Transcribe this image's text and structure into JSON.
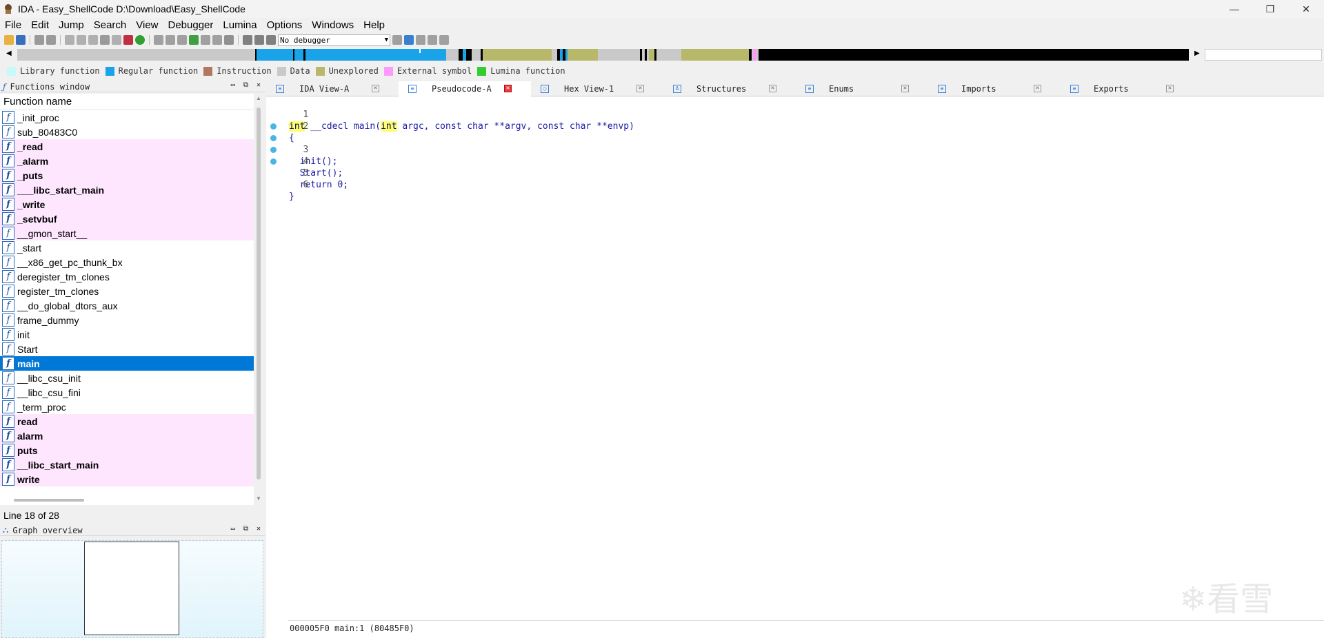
{
  "window": {
    "title": "IDA - Easy_ShellCode D:\\Download\\Easy_ShellCode",
    "minimize": "—",
    "restore": "❐",
    "close": "✕"
  },
  "menu": [
    "File",
    "Edit",
    "Jump",
    "Search",
    "View",
    "Debugger",
    "Lumina",
    "Options",
    "Windows",
    "Help"
  ],
  "toolbar": {
    "debugger_select": "No debugger"
  },
  "legend": [
    {
      "label": "Library function",
      "color": "#c8f8f8"
    },
    {
      "label": "Regular function",
      "color": "#1aa3e8"
    },
    {
      "label": "Instruction",
      "color": "#b07860"
    },
    {
      "label": "Data",
      "color": "#c9c9c9"
    },
    {
      "label": "Unexplored",
      "color": "#b8b86a"
    },
    {
      "label": "External symbol",
      "color": "#ff99ff"
    },
    {
      "label": "Lumina function",
      "color": "#33cc33"
    }
  ],
  "functions_window": {
    "title": "Functions window",
    "column_header": "Function name",
    "items": [
      {
        "name": "_init_proc",
        "kind": "regular"
      },
      {
        "name": "sub_80483C0",
        "kind": "regular"
      },
      {
        "name": "_read",
        "kind": "lib"
      },
      {
        "name": "_alarm",
        "kind": "lib"
      },
      {
        "name": "_puts",
        "kind": "lib"
      },
      {
        "name": "___libc_start_main",
        "kind": "lib"
      },
      {
        "name": "_write",
        "kind": "lib"
      },
      {
        "name": "_setvbuf",
        "kind": "lib"
      },
      {
        "name": "__gmon_start__",
        "kind": "lib-light"
      },
      {
        "name": "_start",
        "kind": "regular"
      },
      {
        "name": "__x86_get_pc_thunk_bx",
        "kind": "regular"
      },
      {
        "name": "deregister_tm_clones",
        "kind": "regular"
      },
      {
        "name": "register_tm_clones",
        "kind": "regular"
      },
      {
        "name": "__do_global_dtors_aux",
        "kind": "regular"
      },
      {
        "name": "frame_dummy",
        "kind": "regular"
      },
      {
        "name": "init",
        "kind": "regular"
      },
      {
        "name": "Start",
        "kind": "regular"
      },
      {
        "name": "main",
        "kind": "selected"
      },
      {
        "name": "__libc_csu_init",
        "kind": "regular"
      },
      {
        "name": "__libc_csu_fini",
        "kind": "regular"
      },
      {
        "name": "_term_proc",
        "kind": "regular"
      },
      {
        "name": "read",
        "kind": "lib"
      },
      {
        "name": "alarm",
        "kind": "lib"
      },
      {
        "name": "puts",
        "kind": "lib"
      },
      {
        "name": "__libc_start_main",
        "kind": "lib"
      },
      {
        "name": "write",
        "kind": "lib"
      }
    ],
    "status": "Line 18 of 28"
  },
  "graph_overview": {
    "title": "Graph overview"
  },
  "tabs": [
    {
      "label": "IDA View-A",
      "active": false
    },
    {
      "label": "Pseudocode-A",
      "active": true
    },
    {
      "label": "Hex View-1",
      "active": false
    },
    {
      "label": "Structures",
      "active": false
    },
    {
      "label": "Enums",
      "active": false
    },
    {
      "label": "Imports",
      "active": false
    },
    {
      "label": "Exports",
      "active": false
    }
  ],
  "pseudocode": {
    "lines": [
      {
        "num": "1",
        "text": "int __cdecl main(int argc, const char **argv, const char **envp)",
        "dot": false
      },
      {
        "num": "2",
        "text": "{",
        "dot": false
      },
      {
        "num": "3",
        "text": "  init();",
        "dot": true
      },
      {
        "num": "4",
        "text": "  Start();",
        "dot": true
      },
      {
        "num": "5",
        "text": "  return 0;",
        "dot": true
      },
      {
        "num": "6",
        "text": "}",
        "dot": true
      }
    ],
    "status": "000005F0 main:1 (80485F0)"
  },
  "watermark": "❄看雪"
}
